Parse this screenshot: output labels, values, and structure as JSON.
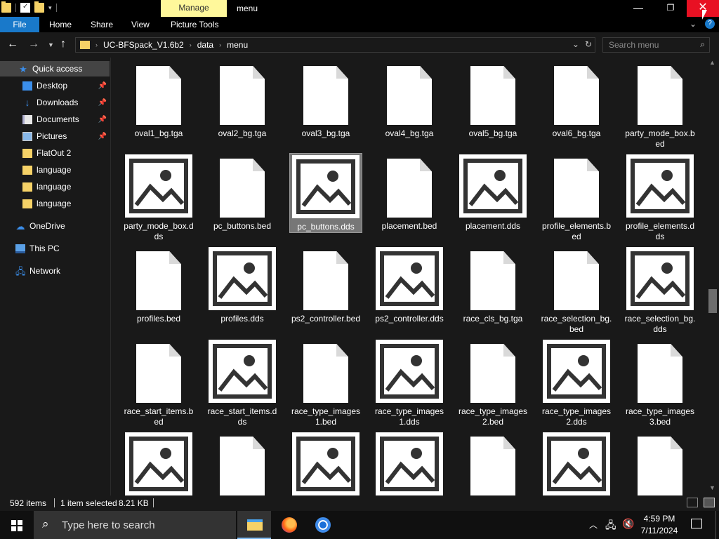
{
  "window": {
    "title": "menu",
    "manage_tab": "Manage",
    "controls": {
      "minimize": "—",
      "maximize": "❐",
      "close": "✕"
    }
  },
  "ribbon": {
    "tabs": [
      "File",
      "Home",
      "Share",
      "View",
      "Picture Tools"
    ],
    "active_color": "#1979ca",
    "collapse_icon": "chevron-down-icon",
    "help_icon": "help-icon"
  },
  "address": {
    "crumbs": [
      "UC-BFSpack_V1.6b2",
      "data",
      "menu"
    ],
    "dropdown_icon": "chevron-down-icon",
    "refresh_icon": "refresh-icon"
  },
  "search": {
    "placeholder": "Search menu"
  },
  "navigation": {
    "items": [
      {
        "label": "Quick access",
        "icon": "star-icon",
        "pinned": false,
        "selected": true
      },
      {
        "label": "Desktop",
        "icon": "desktop-icon",
        "pinned": true
      },
      {
        "label": "Downloads",
        "icon": "download-icon",
        "pinned": true
      },
      {
        "label": "Documents",
        "icon": "documents-icon",
        "pinned": true
      },
      {
        "label": "Pictures",
        "icon": "pictures-icon",
        "pinned": true
      },
      {
        "label": "FlatOut 2",
        "icon": "folder-icon",
        "pinned": false
      },
      {
        "label": "language",
        "icon": "folder-icon",
        "pinned": false
      },
      {
        "label": "language",
        "icon": "folder-icon",
        "pinned": false
      },
      {
        "label": "language",
        "icon": "folder-icon",
        "pinned": false
      },
      {
        "label": "OneDrive",
        "icon": "cloud-icon",
        "pinned": false
      },
      {
        "label": "This PC",
        "icon": "computer-icon",
        "pinned": false
      },
      {
        "label": "Network",
        "icon": "network-icon",
        "pinned": false
      }
    ]
  },
  "files": [
    {
      "name": "oval1_bg.tga",
      "kind": "doc"
    },
    {
      "name": "oval2_bg.tga",
      "kind": "doc"
    },
    {
      "name": "oval3_bg.tga",
      "kind": "doc"
    },
    {
      "name": "oval4_bg.tga",
      "kind": "doc"
    },
    {
      "name": "oval5_bg.tga",
      "kind": "doc"
    },
    {
      "name": "oval6_bg.tga",
      "kind": "doc"
    },
    {
      "name": "party_mode_box.bed",
      "kind": "doc"
    },
    {
      "name": "party_mode_box.dds",
      "kind": "img"
    },
    {
      "name": "pc_buttons.bed",
      "kind": "doc"
    },
    {
      "name": "pc_buttons.dds",
      "kind": "img",
      "selected": true
    },
    {
      "name": "placement.bed",
      "kind": "doc"
    },
    {
      "name": "placement.dds",
      "kind": "img"
    },
    {
      "name": "profile_elements.bed",
      "kind": "doc"
    },
    {
      "name": "profile_elements.dds",
      "kind": "img"
    },
    {
      "name": "profiles.bed",
      "kind": "doc"
    },
    {
      "name": "profiles.dds",
      "kind": "img"
    },
    {
      "name": "ps2_controller.bed",
      "kind": "doc"
    },
    {
      "name": "ps2_controller.dds",
      "kind": "img"
    },
    {
      "name": "race_cls_bg.tga",
      "kind": "doc"
    },
    {
      "name": "race_selection_bg.bed",
      "kind": "doc"
    },
    {
      "name": "race_selection_bg.dds",
      "kind": "img"
    },
    {
      "name": "race_start_items.bed",
      "kind": "doc"
    },
    {
      "name": "race_start_items.dds",
      "kind": "img"
    },
    {
      "name": "race_type_images1.bed",
      "kind": "doc"
    },
    {
      "name": "race_type_images1.dds",
      "kind": "img"
    },
    {
      "name": "race_type_images2.bed",
      "kind": "doc"
    },
    {
      "name": "race_type_images2.dds",
      "kind": "img"
    },
    {
      "name": "race_type_images3.bed",
      "kind": "doc"
    },
    {
      "name": "",
      "kind": "img"
    },
    {
      "name": "",
      "kind": "doc"
    },
    {
      "name": "",
      "kind": "img"
    },
    {
      "name": "",
      "kind": "img"
    },
    {
      "name": "",
      "kind": "doc"
    },
    {
      "name": "",
      "kind": "img"
    },
    {
      "name": "",
      "kind": "doc"
    }
  ],
  "status": {
    "item_count": "592 items",
    "selected": "1 item selected",
    "size": "8.21 KB"
  },
  "taskbar": {
    "search_placeholder": "Type here to search",
    "apps": [
      "file-explorer-icon",
      "firefox-icon",
      "chrome-icon"
    ],
    "time": "4:59 PM",
    "date": "7/11/2024"
  },
  "colors": {
    "background": "#191919",
    "close_button": "#e81123",
    "manage_tab": "#fff89b",
    "selection": "#777777"
  }
}
